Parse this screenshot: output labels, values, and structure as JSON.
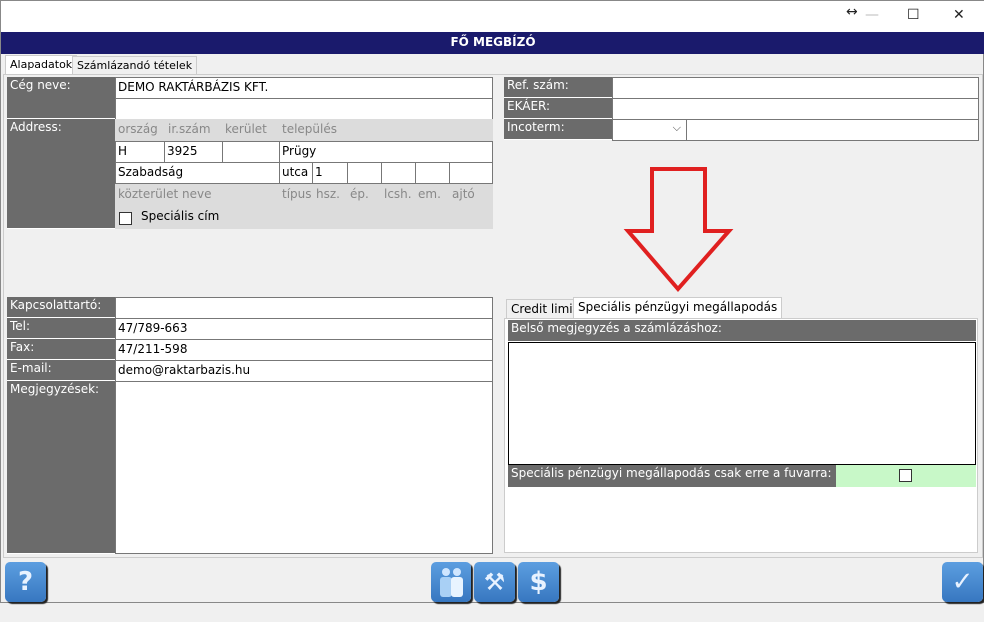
{
  "window": {
    "title": "FŐ MEGBÍZÓ",
    "controls": [
      "resize",
      "minimize",
      "maximize",
      "close"
    ]
  },
  "tabs": [
    {
      "label": "Alapadatok",
      "active": true
    },
    {
      "label": "Számlázandó tételek",
      "active": false
    }
  ],
  "company": {
    "label": "Cég neve:",
    "value": "DEMO RAKTÁRBÁZIS KFT.",
    "value2": ""
  },
  "address": {
    "label": "Address:",
    "headers": {
      "country": "ország",
      "zip": "ir.szám",
      "district": "kerület",
      "city": "település",
      "street": "közterület neve",
      "type": "típus",
      "number": "hsz.",
      "building": "ép.",
      "stair": "lcsh.",
      "floor": "em.",
      "door": "ajtó"
    },
    "country": "H",
    "zip": "3925",
    "district": "",
    "city": "Prügy",
    "street": "Szabadság",
    "type": "utca",
    "number": "1",
    "building": "",
    "stair": "",
    "floor": "",
    "door": "",
    "special_label": "Speciális cím",
    "special_checked": false
  },
  "contact": {
    "person_label": "Kapcsolattartó:",
    "person": "",
    "tel_label": "Tel:",
    "tel": "47/789-663",
    "fax_label": "Fax:",
    "fax": "47/211-598",
    "email_label": "E-mail:",
    "email": "demo@raktarbazis.hu",
    "notes_label": "Megjegyzések:",
    "notes": ""
  },
  "right": {
    "ref_label": "Ref. szám:",
    "ref": "",
    "ekaer_label": "EKÁER:",
    "ekaer": "",
    "incoterm_label": "Incoterm:",
    "incoterm": "",
    "incoterm_text": ""
  },
  "sub_tabs": [
    {
      "label": "Credit limit",
      "active": false
    },
    {
      "label": "Speciális pénzügyi megállapodás",
      "active": true
    }
  ],
  "special": {
    "note_label": "Belső megjegyzés a számlázáshoz:",
    "note": "",
    "only_this_label": "Speciális pénzügyi megállapodás csak erre a fuvarra:",
    "only_this_checked": false
  },
  "buttons": {
    "help": "?",
    "contacts": "contacts-icon",
    "tools": "tools-icon",
    "finance": "$",
    "ok": "✓"
  },
  "colors": {
    "title_band": "#1a1a6c",
    "label_bg": "#6b6b6b",
    "green": "#c8f8c8",
    "arrow": "#e02020",
    "button": "#4a8ad0"
  }
}
